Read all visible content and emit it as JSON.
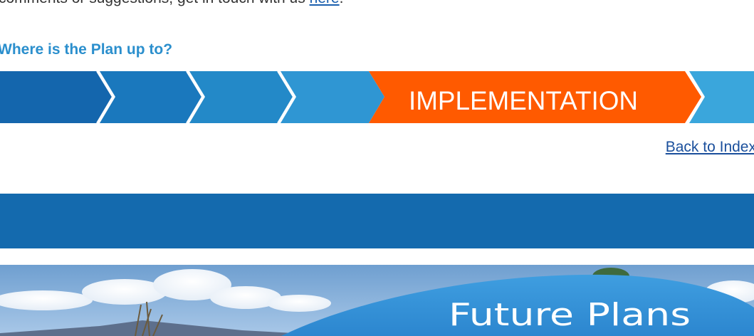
{
  "intro": {
    "text": "comments or suggestions, get in touch with us ",
    "link_label": "here",
    "suffix": "."
  },
  "plan_status": {
    "heading": "Where is the Plan up to?",
    "current_stage_label": "IMPLEMENTATION"
  },
  "navigation": {
    "back_label": "Back to Index"
  },
  "banner": {
    "title": "Future Plans"
  },
  "colors": {
    "stage_dark": "#1466ad",
    "stage_mid": "#1a78bd",
    "stage_light": "#2389c8",
    "stage_lighter": "#2f96d3",
    "stage_current": "#ff5a00",
    "stage_next": "#3aa6dc",
    "heading_blue": "#2b8fcd",
    "band_blue": "#146aae",
    "link_blue": "#1a4f9c"
  }
}
